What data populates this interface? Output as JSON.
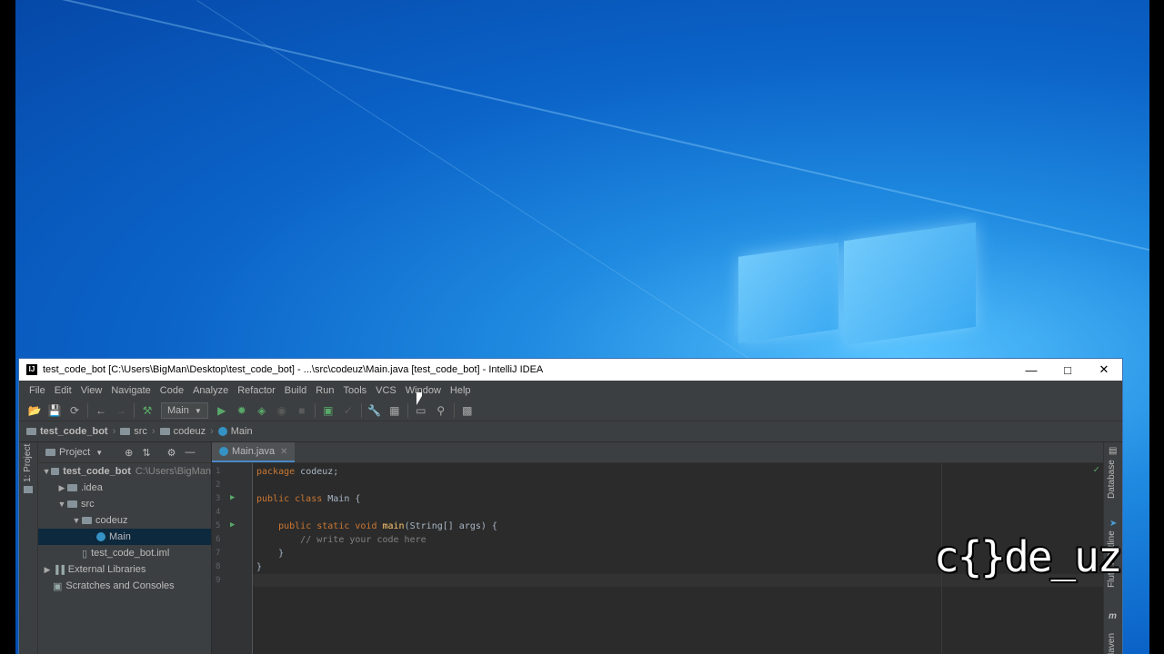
{
  "window": {
    "title": "test_code_bot [C:\\Users\\BigMan\\Desktop\\test_code_bot] - ...\\src\\codeuz\\Main.java [test_code_bot] - IntelliJ IDEA",
    "app_icon": "IJ"
  },
  "menu": [
    "File",
    "Edit",
    "View",
    "Navigate",
    "Code",
    "Analyze",
    "Refactor",
    "Build",
    "Run",
    "Tools",
    "VCS",
    "Window",
    "Help"
  ],
  "toolbar": {
    "run_config": "Main"
  },
  "breadcrumb": [
    "test_code_bot",
    "src",
    "codeuz",
    "Main"
  ],
  "left_strip": {
    "label": "1: Project"
  },
  "project": {
    "header": "Project",
    "tree": [
      {
        "label": "test_code_bot",
        "hint": "C:\\Users\\BigMan",
        "indent": 0,
        "arrow": "▼",
        "icon": "folder"
      },
      {
        "label": ".idea",
        "indent": 1,
        "arrow": "▶",
        "icon": "folder"
      },
      {
        "label": "src",
        "indent": 1,
        "arrow": "▼",
        "icon": "folder"
      },
      {
        "label": "codeuz",
        "indent": 2,
        "arrow": "▼",
        "icon": "folder"
      },
      {
        "label": "Main",
        "indent": 3,
        "arrow": "",
        "icon": "class",
        "selected": true
      },
      {
        "label": "test_code_bot.iml",
        "indent": 2,
        "arrow": "",
        "icon": "file"
      },
      {
        "label": "External Libraries",
        "indent": 0,
        "arrow": "▶",
        "icon": "library"
      },
      {
        "label": "Scratches and Consoles",
        "indent": 0,
        "arrow": "",
        "icon": "scratch"
      }
    ]
  },
  "editor": {
    "tab": "Main.java",
    "line_numbers": [
      "1",
      "2",
      "3",
      "4",
      "5",
      "6",
      "7",
      "8",
      "9"
    ],
    "code": {
      "l1_kw": "package",
      "l1_rest": " codeuz;",
      "l3_kw": "public class",
      "l3_rest": " Main {",
      "l5_kw": "public static void",
      "l5_fn": "main",
      "l5_rest": "(String[] args) {",
      "l6": "// write your code here",
      "l7": "}",
      "l8": "}"
    }
  },
  "right_strip": {
    "items": [
      "Database",
      "Flutter Outline",
      "Maven"
    ]
  },
  "watermark": "c{}de_uz"
}
